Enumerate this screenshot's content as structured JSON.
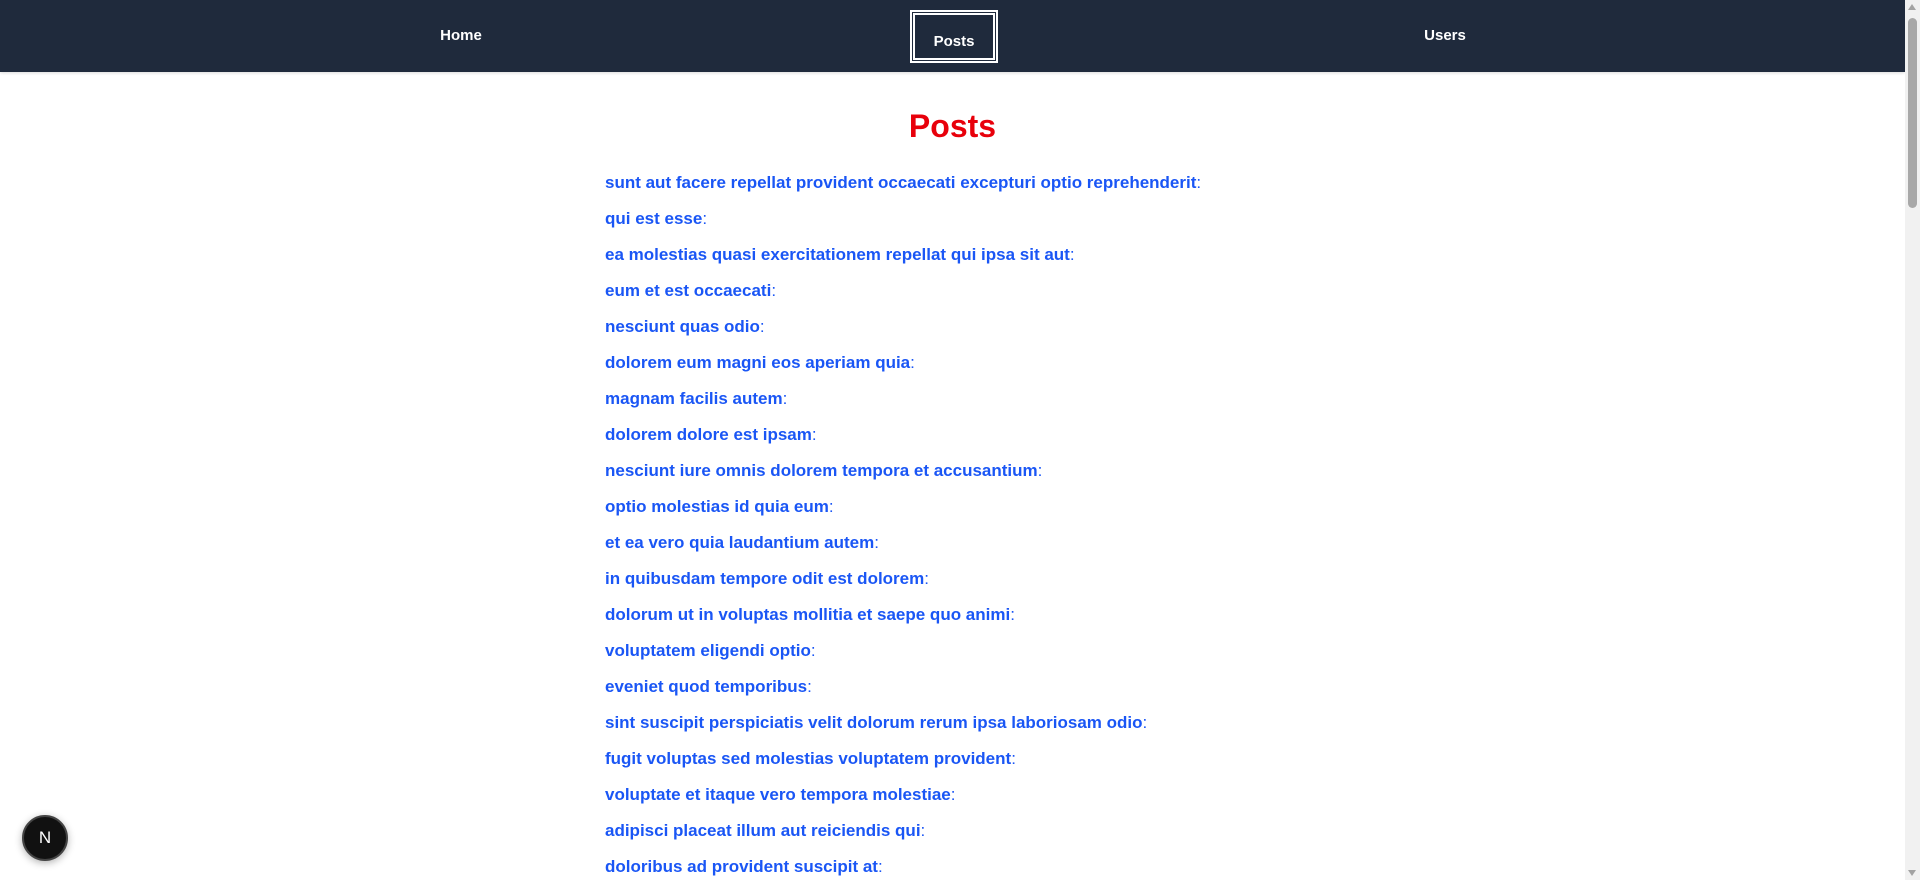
{
  "nav": {
    "items": [
      {
        "label": "Home"
      },
      {
        "label": "Posts",
        "active": true
      },
      {
        "label": "Users"
      }
    ]
  },
  "page": {
    "title": "Posts"
  },
  "posts": [
    "sunt aut facere repellat provident occaecati excepturi optio reprehenderit",
    "qui est esse",
    "ea molestias quasi exercitationem repellat qui ipsa sit aut",
    "eum et est occaecati",
    "nesciunt quas odio",
    "dolorem eum magni eos aperiam quia",
    "magnam facilis autem",
    "dolorem dolore est ipsam",
    "nesciunt iure omnis dolorem tempora et accusantium",
    "optio molestias id quia eum",
    "et ea vero quia laudantium autem",
    "in quibusdam tempore odit est dolorem",
    "dolorum ut in voluptas mollitia et saepe quo animi",
    "voluptatem eligendi optio",
    "eveniet quod temporibus",
    "sint suscipit perspiciatis velit dolorum rerum ipsa laboriosam odio",
    "fugit voluptas sed molestias voluptatem provident",
    "voluptate et itaque vero tempora molestiae",
    "adipisci placeat illum aut reiciendis qui",
    "doloribus ad provident suscipit at"
  ],
  "separator": ":",
  "devtools_badge": {
    "label": "N"
  },
  "colors": {
    "nav_bg": "#1f2a3c",
    "title": "#e8000b",
    "link": "#1a56f5"
  }
}
